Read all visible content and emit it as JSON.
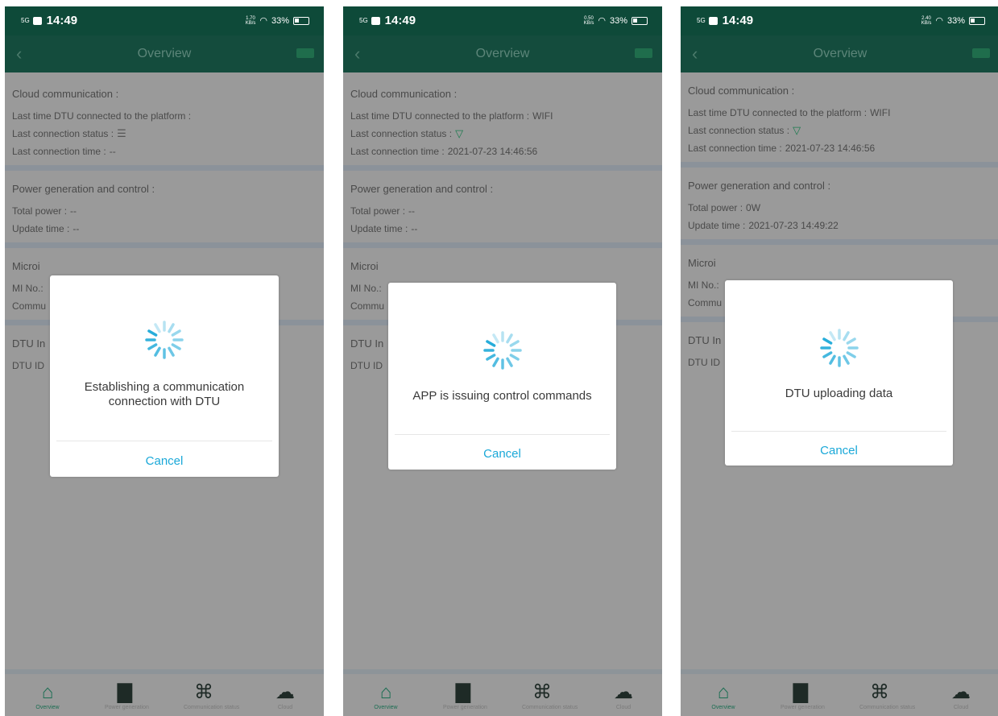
{
  "status_bar": {
    "time": "14:49",
    "signal": "5G",
    "battery": "33%",
    "net_speeds": [
      "1.70",
      "0.50",
      "2.40"
    ],
    "net_unit": "KB/s"
  },
  "navbar": {
    "title": "Overview",
    "back_icon": "chevron-left-icon"
  },
  "sections": {
    "cloud_title": "Cloud communication :",
    "last_dtu_label": "Last time DTU connected to the platform :",
    "last_status_label": "Last connection status :",
    "last_time_label": "Last connection time :",
    "power_title": "Power generation and control :",
    "total_power_label": "Total power :",
    "update_time_label": "Update time :",
    "micro_title": "Microi",
    "mi_no_label": "MI No.:",
    "comm_label": "Commu",
    "dtu_info_title": "DTU In",
    "dtu_id_label": "DTU ID"
  },
  "screens": [
    {
      "last_dtu_value": "",
      "last_time_value": "--",
      "total_power_value": "--",
      "update_time_value": "--",
      "dialog_message": "Establishing a communication connection with DTU",
      "cancel_label": "Cancel"
    },
    {
      "last_dtu_value": "WIFI",
      "last_time_value": "2021-07-23 14:46:56",
      "total_power_value": "--",
      "update_time_value": "--",
      "dialog_message": "APP is issuing control commands",
      "cancel_label": "Cancel"
    },
    {
      "last_dtu_value": "WIFI",
      "last_time_value": "2021-07-23 14:46:56",
      "total_power_value": "0W",
      "update_time_value": "2021-07-23 14:49:22",
      "dialog_message": "DTU uploading data",
      "cancel_label": "Cancel"
    }
  ],
  "tabbar": {
    "items": [
      {
        "icon": "home-icon",
        "label": "Overview"
      },
      {
        "icon": "bar-chart-icon",
        "label": "Power generation"
      },
      {
        "icon": "network-icon",
        "label": "Communication status"
      },
      {
        "icon": "cloud-icon",
        "label": "Cloud"
      }
    ]
  },
  "colors": {
    "header_green": "#0e4a39",
    "spinner_blue": "#1aa8d8",
    "cancel_blue": "#1aa8d8",
    "active_tab": "#1c6e53",
    "overlay_gray": "#9a9a9a"
  }
}
